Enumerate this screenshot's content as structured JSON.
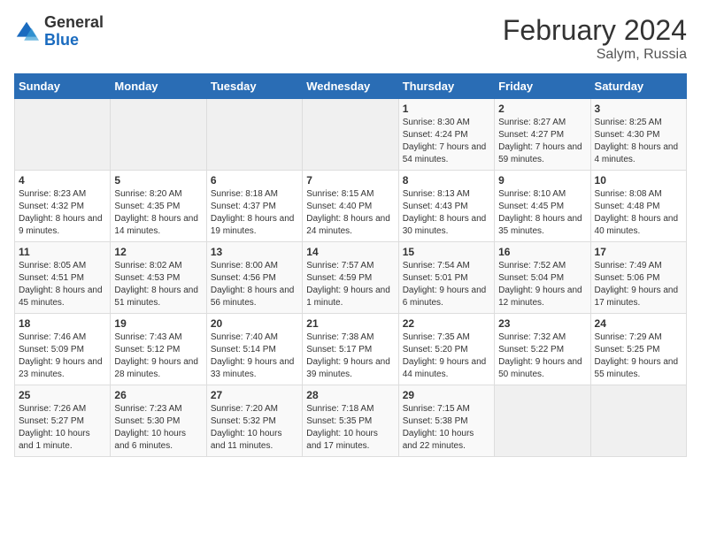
{
  "header": {
    "logo_general": "General",
    "logo_blue": "Blue",
    "main_title": "February 2024",
    "sub_title": "Salym, Russia"
  },
  "days_of_week": [
    "Sunday",
    "Monday",
    "Tuesday",
    "Wednesday",
    "Thursday",
    "Friday",
    "Saturday"
  ],
  "weeks": [
    [
      {
        "day": "",
        "sunrise": "",
        "sunset": "",
        "daylight": "",
        "empty": true
      },
      {
        "day": "",
        "sunrise": "",
        "sunset": "",
        "daylight": "",
        "empty": true
      },
      {
        "day": "",
        "sunrise": "",
        "sunset": "",
        "daylight": "",
        "empty": true
      },
      {
        "day": "",
        "sunrise": "",
        "sunset": "",
        "daylight": "",
        "empty": true
      },
      {
        "day": "1",
        "sunrise": "Sunrise: 8:30 AM",
        "sunset": "Sunset: 4:24 PM",
        "daylight": "Daylight: 7 hours and 54 minutes.",
        "empty": false
      },
      {
        "day": "2",
        "sunrise": "Sunrise: 8:27 AM",
        "sunset": "Sunset: 4:27 PM",
        "daylight": "Daylight: 7 hours and 59 minutes.",
        "empty": false
      },
      {
        "day": "3",
        "sunrise": "Sunrise: 8:25 AM",
        "sunset": "Sunset: 4:30 PM",
        "daylight": "Daylight: 8 hours and 4 minutes.",
        "empty": false
      }
    ],
    [
      {
        "day": "4",
        "sunrise": "Sunrise: 8:23 AM",
        "sunset": "Sunset: 4:32 PM",
        "daylight": "Daylight: 8 hours and 9 minutes.",
        "empty": false
      },
      {
        "day": "5",
        "sunrise": "Sunrise: 8:20 AM",
        "sunset": "Sunset: 4:35 PM",
        "daylight": "Daylight: 8 hours and 14 minutes.",
        "empty": false
      },
      {
        "day": "6",
        "sunrise": "Sunrise: 8:18 AM",
        "sunset": "Sunset: 4:37 PM",
        "daylight": "Daylight: 8 hours and 19 minutes.",
        "empty": false
      },
      {
        "day": "7",
        "sunrise": "Sunrise: 8:15 AM",
        "sunset": "Sunset: 4:40 PM",
        "daylight": "Daylight: 8 hours and 24 minutes.",
        "empty": false
      },
      {
        "day": "8",
        "sunrise": "Sunrise: 8:13 AM",
        "sunset": "Sunset: 4:43 PM",
        "daylight": "Daylight: 8 hours and 30 minutes.",
        "empty": false
      },
      {
        "day": "9",
        "sunrise": "Sunrise: 8:10 AM",
        "sunset": "Sunset: 4:45 PM",
        "daylight": "Daylight: 8 hours and 35 minutes.",
        "empty": false
      },
      {
        "day": "10",
        "sunrise": "Sunrise: 8:08 AM",
        "sunset": "Sunset: 4:48 PM",
        "daylight": "Daylight: 8 hours and 40 minutes.",
        "empty": false
      }
    ],
    [
      {
        "day": "11",
        "sunrise": "Sunrise: 8:05 AM",
        "sunset": "Sunset: 4:51 PM",
        "daylight": "Daylight: 8 hours and 45 minutes.",
        "empty": false
      },
      {
        "day": "12",
        "sunrise": "Sunrise: 8:02 AM",
        "sunset": "Sunset: 4:53 PM",
        "daylight": "Daylight: 8 hours and 51 minutes.",
        "empty": false
      },
      {
        "day": "13",
        "sunrise": "Sunrise: 8:00 AM",
        "sunset": "Sunset: 4:56 PM",
        "daylight": "Daylight: 8 hours and 56 minutes.",
        "empty": false
      },
      {
        "day": "14",
        "sunrise": "Sunrise: 7:57 AM",
        "sunset": "Sunset: 4:59 PM",
        "daylight": "Daylight: 9 hours and 1 minute.",
        "empty": false
      },
      {
        "day": "15",
        "sunrise": "Sunrise: 7:54 AM",
        "sunset": "Sunset: 5:01 PM",
        "daylight": "Daylight: 9 hours and 6 minutes.",
        "empty": false
      },
      {
        "day": "16",
        "sunrise": "Sunrise: 7:52 AM",
        "sunset": "Sunset: 5:04 PM",
        "daylight": "Daylight: 9 hours and 12 minutes.",
        "empty": false
      },
      {
        "day": "17",
        "sunrise": "Sunrise: 7:49 AM",
        "sunset": "Sunset: 5:06 PM",
        "daylight": "Daylight: 9 hours and 17 minutes.",
        "empty": false
      }
    ],
    [
      {
        "day": "18",
        "sunrise": "Sunrise: 7:46 AM",
        "sunset": "Sunset: 5:09 PM",
        "daylight": "Daylight: 9 hours and 23 minutes.",
        "empty": false
      },
      {
        "day": "19",
        "sunrise": "Sunrise: 7:43 AM",
        "sunset": "Sunset: 5:12 PM",
        "daylight": "Daylight: 9 hours and 28 minutes.",
        "empty": false
      },
      {
        "day": "20",
        "sunrise": "Sunrise: 7:40 AM",
        "sunset": "Sunset: 5:14 PM",
        "daylight": "Daylight: 9 hours and 33 minutes.",
        "empty": false
      },
      {
        "day": "21",
        "sunrise": "Sunrise: 7:38 AM",
        "sunset": "Sunset: 5:17 PM",
        "daylight": "Daylight: 9 hours and 39 minutes.",
        "empty": false
      },
      {
        "day": "22",
        "sunrise": "Sunrise: 7:35 AM",
        "sunset": "Sunset: 5:20 PM",
        "daylight": "Daylight: 9 hours and 44 minutes.",
        "empty": false
      },
      {
        "day": "23",
        "sunrise": "Sunrise: 7:32 AM",
        "sunset": "Sunset: 5:22 PM",
        "daylight": "Daylight: 9 hours and 50 minutes.",
        "empty": false
      },
      {
        "day": "24",
        "sunrise": "Sunrise: 7:29 AM",
        "sunset": "Sunset: 5:25 PM",
        "daylight": "Daylight: 9 hours and 55 minutes.",
        "empty": false
      }
    ],
    [
      {
        "day": "25",
        "sunrise": "Sunrise: 7:26 AM",
        "sunset": "Sunset: 5:27 PM",
        "daylight": "Daylight: 10 hours and 1 minute.",
        "empty": false
      },
      {
        "day": "26",
        "sunrise": "Sunrise: 7:23 AM",
        "sunset": "Sunset: 5:30 PM",
        "daylight": "Daylight: 10 hours and 6 minutes.",
        "empty": false
      },
      {
        "day": "27",
        "sunrise": "Sunrise: 7:20 AM",
        "sunset": "Sunset: 5:32 PM",
        "daylight": "Daylight: 10 hours and 11 minutes.",
        "empty": false
      },
      {
        "day": "28",
        "sunrise": "Sunrise: 7:18 AM",
        "sunset": "Sunset: 5:35 PM",
        "daylight": "Daylight: 10 hours and 17 minutes.",
        "empty": false
      },
      {
        "day": "29",
        "sunrise": "Sunrise: 7:15 AM",
        "sunset": "Sunset: 5:38 PM",
        "daylight": "Daylight: 10 hours and 22 minutes.",
        "empty": false
      },
      {
        "day": "",
        "sunrise": "",
        "sunset": "",
        "daylight": "",
        "empty": true
      },
      {
        "day": "",
        "sunrise": "",
        "sunset": "",
        "daylight": "",
        "empty": true
      }
    ]
  ]
}
